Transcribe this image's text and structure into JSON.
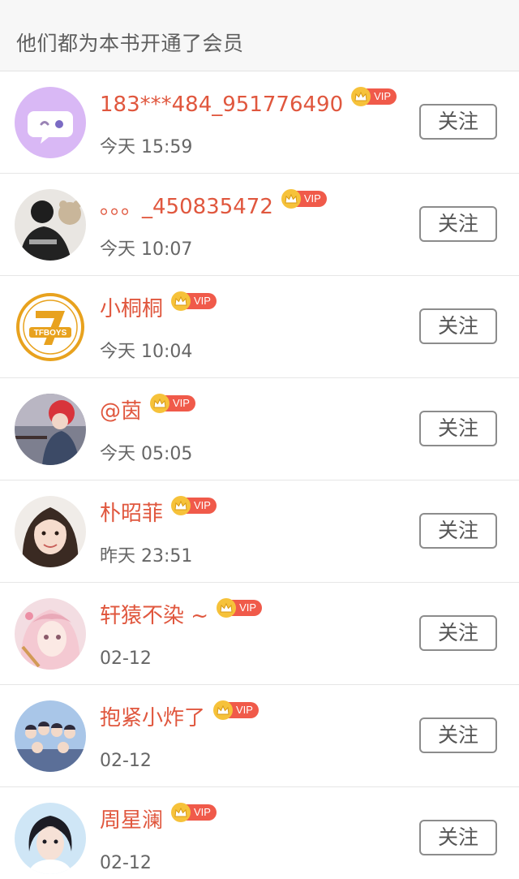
{
  "header": {
    "title": "他们都为本书开通了会员"
  },
  "vip_label": "VIP",
  "follow_label": "关注",
  "colors": {
    "name": "#e0573e",
    "vip_tag": "#f05a4a",
    "crown": "#f6c23a"
  },
  "members": [
    {
      "name": "183***484_951776490",
      "time": "今天 15:59",
      "avatar": "chat-bubble"
    },
    {
      "name": "。。。_450835472",
      "time": "今天 10:07",
      "avatar": "photo-person-bear"
    },
    {
      "name": "小桐桐",
      "time": "今天 10:04",
      "avatar": "tfboys-logo"
    },
    {
      "name": "@茵",
      "time": "今天 05:05",
      "avatar": "photo-girl-red-hat"
    },
    {
      "name": "朴昭菲",
      "time": "昨天 23:51",
      "avatar": "photo-girl-portrait"
    },
    {
      "name": "轩猿不染 ~",
      "time": "02-12",
      "avatar": "anime-character"
    },
    {
      "name": "抱紧小炸了",
      "time": "02-12",
      "avatar": "photo-group"
    },
    {
      "name": "周星澜",
      "time": "02-12",
      "avatar": "photo-young-man"
    }
  ],
  "tfboys_logo_text": "TFBOYS"
}
